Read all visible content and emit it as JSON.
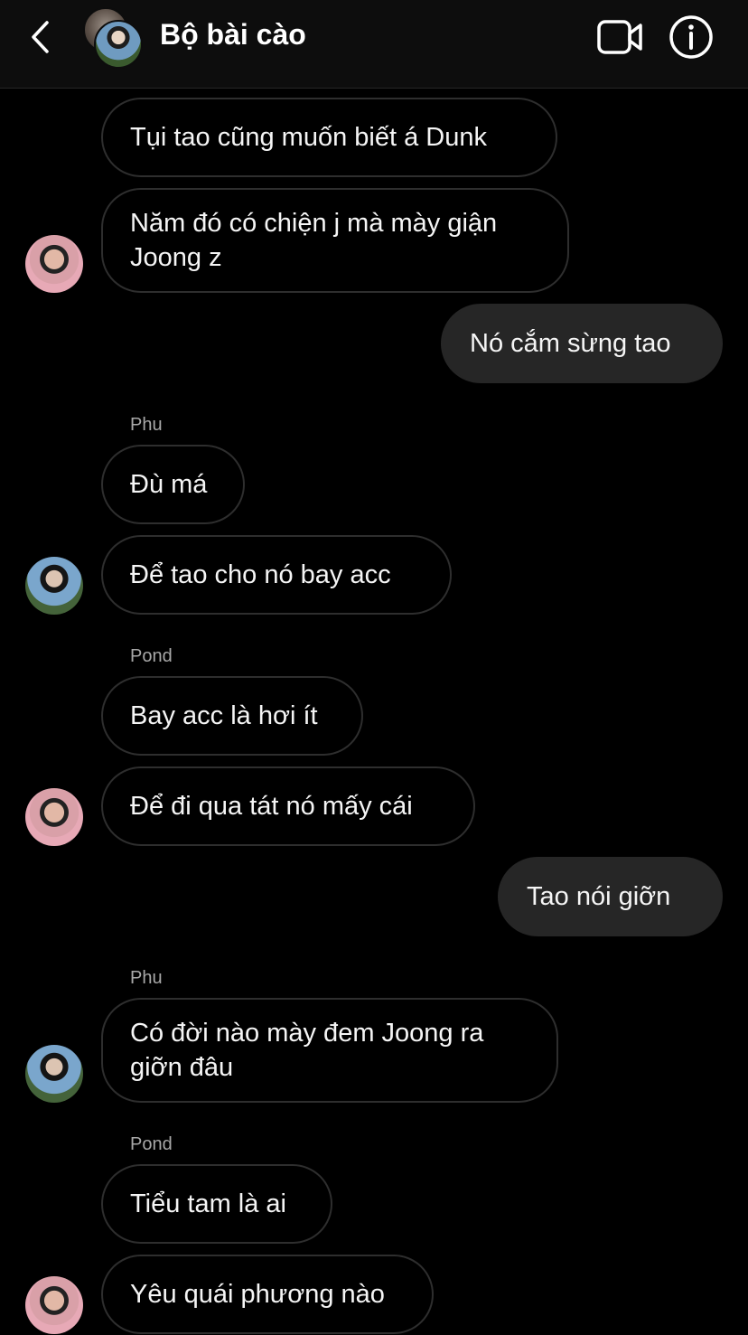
{
  "header": {
    "title": "Bộ bài cào",
    "back_icon": "chevron-left-icon",
    "video_icon": "video-camera-icon",
    "info_icon": "info-circle-icon"
  },
  "messages": [
    {
      "text": "Tụi tao cũng muốn biết á Dunk",
      "from": "other"
    },
    {
      "text": "Năm đó có chiện j mà mày giận Joong z",
      "from": "other"
    },
    {
      "text": "Nó cắm sừng tao",
      "from": "me"
    },
    {
      "sender": "Phu",
      "text": "Đù má",
      "from": "other"
    },
    {
      "text": "Để tao cho nó bay acc",
      "from": "other"
    },
    {
      "sender": "Pond",
      "text": "Bay acc là hơi ít",
      "from": "other"
    },
    {
      "text": "Để đi qua tát nó mấy cái",
      "from": "other"
    },
    {
      "text": "Tao nói giỡn",
      "from": "me"
    },
    {
      "sender": "Phu",
      "text": "Có đời nào mày đem Joong ra giỡn đâu",
      "from": "other"
    },
    {
      "sender": "Pond",
      "text": "Tiểu tam là ai",
      "from": "other"
    },
    {
      "text": "Yêu quái phương nào",
      "from": "other"
    }
  ],
  "senders": {
    "phu_1": "Phu",
    "pond_1": "Pond",
    "phu_2": "Phu",
    "pond_2": "Pond"
  },
  "colors": {
    "background": "#000000",
    "my_bubble": "#262626",
    "bubble_border": "#2e2e2e",
    "sender_name": "#a8a8a8"
  }
}
